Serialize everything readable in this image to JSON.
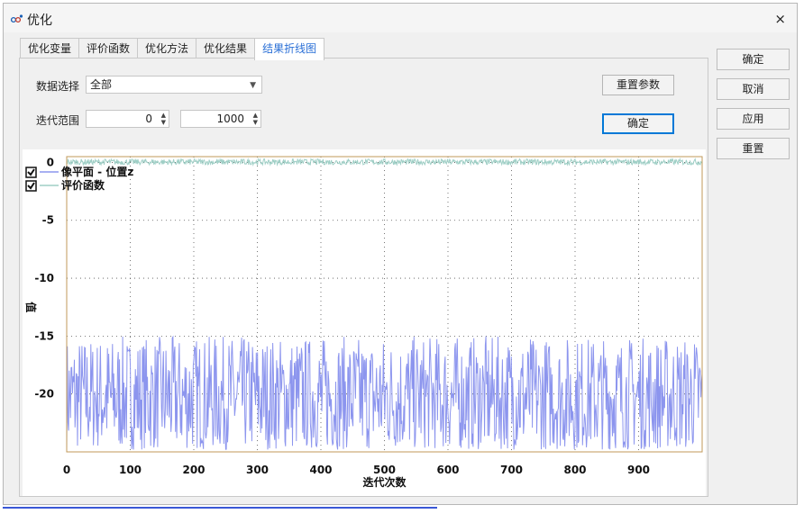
{
  "window": {
    "title": "优化",
    "close_glyph": "×"
  },
  "tabs": [
    {
      "label": "优化变量",
      "active": false
    },
    {
      "label": "评价函数",
      "active": false
    },
    {
      "label": "优化方法",
      "active": false
    },
    {
      "label": "优化结果",
      "active": false
    },
    {
      "label": "结果折线图",
      "active": true
    }
  ],
  "controls": {
    "data_select_label": "数据选择",
    "data_select_value": "全部",
    "range_label": "迭代范围",
    "range_start": "0",
    "range_end": "1000",
    "reset_params_label": "重置参数",
    "confirm_label": "确定"
  },
  "side_buttons": {
    "ok": "确定",
    "cancel": "取消",
    "apply": "应用",
    "reset": "重置"
  },
  "colors": {
    "series1": "#8c95ee",
    "series2": "#9fcfc6",
    "plot_border": "#c09a5a",
    "accent": "#0078d7"
  },
  "chart_data": {
    "type": "line",
    "xlabel": "迭代次数",
    "ylabel": "值",
    "xlim": [
      0,
      1000
    ],
    "ylim": [
      -25,
      0.5
    ],
    "x_ticks": [
      "0",
      "100",
      "200",
      "300",
      "400",
      "500",
      "600",
      "700",
      "800",
      "900"
    ],
    "y_ticks": [
      "0",
      "-5",
      "-10",
      "-15",
      "-20"
    ],
    "grid": true,
    "legend_position": "top-left",
    "series": [
      {
        "name": "像平面 - 位置z",
        "pattern": "noisy",
        "range": [
          -24.8,
          -15.0
        ],
        "points": 1000
      },
      {
        "name": "评价函数",
        "pattern": "noisy",
        "range": [
          -0.2,
          0.3
        ],
        "points": 1000
      }
    ]
  }
}
